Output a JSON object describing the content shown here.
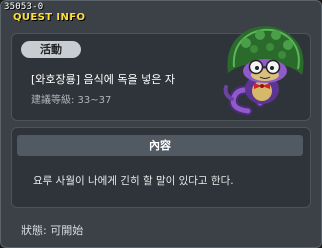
{
  "window": {
    "quest_id": "35053-0",
    "title": "QUEST INFO"
  },
  "summary": {
    "badge": "活動",
    "quest_name": "[와호장룡] 음식에 독을 넣은 자",
    "level_requirement": "建議等級: 33~37"
  },
  "content": {
    "section_title": "內容",
    "description": "요루 사월이 나에게 긴히 할 말이 있다고 한다."
  },
  "status": {
    "text": "狀態:  可開始"
  },
  "npc": {
    "icon": "snake-mage-npc-icon"
  }
}
